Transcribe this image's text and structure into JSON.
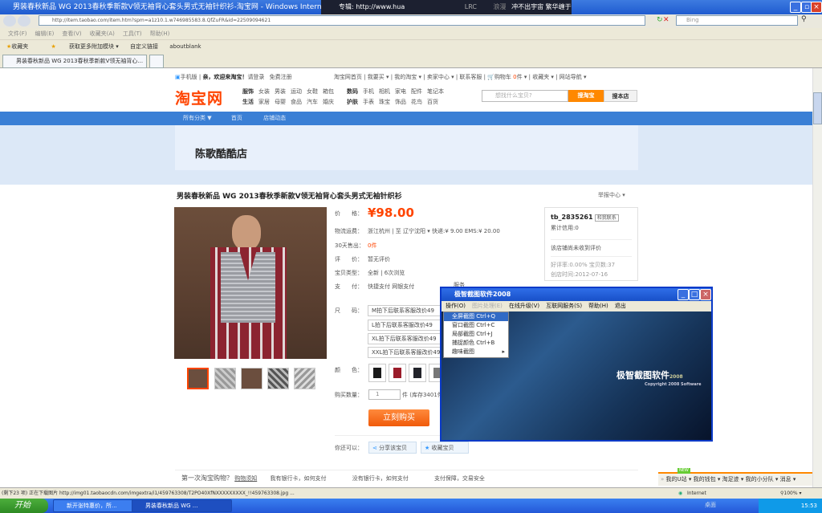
{
  "browser": {
    "title": "男装春秋新品 WG 2013春秋季新款V领无袖背心套头男式无袖针织衫-淘宝网 - Windows Internet",
    "url": "http://item.taobao.com/item.htm?spm=a1z10.1.w746985583.8.QfZuFR&id=22509094621",
    "search_placeholder": "Bing",
    "menu": [
      "文件(F)",
      "编辑(E)",
      "查看(V)",
      "收藏夹(A)",
      "工具(T)",
      "帮助(H)"
    ],
    "favorites": [
      "收藏夹",
      "获取更多附加模块 ▾",
      "自定义链接",
      "aboutblank"
    ],
    "tab": "男装春秋新品 WG 2013春秋季新款V领无袖背心...",
    "status": "(剩下23 项) 正在下载图片 http://img01.taobaocdn.com/imgextra/i1/459763308/T2PO40XfNXXXXXXXXX_!!459763308.jpg ...",
    "zone": "Internet",
    "zoom": "100%"
  },
  "player": {
    "label": "专辑: http://www.hua",
    "lyric_prefix": "浪漫",
    "lyric": "冲不出宇宙  繁华缠于大海",
    "lrc": "LRC"
  },
  "taobao": {
    "topbar": {
      "mobile": "手机版",
      "welcome": "亲，欢迎来淘宝！",
      "login": "请登录",
      "register": "免费注册",
      "links": [
        "淘宝网首页",
        "我要买 ▾",
        "我的淘宝 ▾",
        "卖家中心 ▾",
        "联系客服"
      ],
      "cart": "购物车",
      "cart_count": "0",
      "cart_unit": "件 ▾",
      "fav": "收藏夹 ▾",
      "sitenav": "网站导航 ▾"
    },
    "logo": "淘宝网",
    "cats_row1": [
      "服饰",
      "女装",
      "男装",
      "运动",
      "女鞋",
      "箱包",
      "数码",
      "手机",
      "相机",
      "家电",
      "配件",
      "笔记本"
    ],
    "cats_row2": [
      "生活",
      "家居",
      "母婴",
      "食品",
      "汽车",
      "婚庆",
      "护肤",
      "手表",
      "珠宝",
      "饰品",
      "花鸟",
      "百货"
    ],
    "search_placeholder": "想找什么宝贝?",
    "search_btn": "搜淘宝",
    "shop_btn": "搜本店",
    "nav": [
      "所有分类 ▼",
      "首页",
      "店铺动态"
    ]
  },
  "shop": {
    "name": "陈歌酷酷店"
  },
  "product": {
    "title": "男装春秋新品 WG 2013春秋季新款V领无袖背心套头男式无袖针织衫",
    "report": "举报中心",
    "price_label": "价　　格：",
    "price": "¥98.00",
    "ship_label": "物流运费：",
    "ship": "浙江杭州 | 至 辽宁沈阳 ▾   快递:¥ 9.00   EMS:¥ 20.00",
    "sold_label": "30天售出：",
    "sold": "0件",
    "review_label": "评　　价：",
    "review": "暂无评价",
    "type_label": "宝贝类型：",
    "type": "全新  |  6次浏览",
    "pay_label": "支　　付：",
    "pay": "快捷支付  网银支付",
    "service": "服务",
    "size_label": "尺　　码：",
    "sizes": [
      "M拍下后联系客服改价49",
      "L拍下后联系客服改价49",
      "XL拍下后联系客服改价49",
      "XXL拍下后联系客服改价49"
    ],
    "color_label": "颜　　色：",
    "colors": [
      "#1a1a1a",
      "#9a1c2a",
      "#22232a",
      "#777777"
    ],
    "qty_label": "购买数量：",
    "qty": "1",
    "qty_unit": "件 (库存3401件)",
    "buy": "立刻购买",
    "also_label": "你还可以：",
    "share": "分享该宝贝",
    "collect": "收藏宝贝"
  },
  "seller": {
    "name": "tb_2835261",
    "chat": "和我联系",
    "credit": "累计信用:0",
    "no_review": "该店铺尚未收到评价",
    "rate": "好评率:0.00%  宝贝数:37",
    "created": "创店时间:2012-07-16"
  },
  "dialog": {
    "title": "极智截图软件2008",
    "menu": [
      "操作(O)",
      "图片处理(E)",
      "在线升级(V)",
      "互联网服务(S)",
      "帮助(H)",
      "退出"
    ],
    "items": [
      {
        "label": "全屏截图",
        "key": "Ctrl+Q"
      },
      {
        "label": "窗口截图",
        "key": "Ctrl+C"
      },
      {
        "label": "局部截图",
        "key": "Ctrl+J"
      },
      {
        "label": "捕捉颜色",
        "key": "Ctrl+B"
      },
      {
        "label": "趣味截图",
        "key": "▸"
      }
    ],
    "brand": "极智截图软件",
    "brand_year": "2008",
    "copyright": "Copyright 2008 Software"
  },
  "footer": {
    "q": "第一次淘宝购物？",
    "link": "购物须知",
    "items": [
      "我有银行卡，如何支付",
      "没有银行卡，如何支付",
      "支付保障，交易安全"
    ]
  },
  "tbtoolbar": {
    "badge": "NEW",
    "items": [
      "我的U站 ▾",
      "我的钱包 ▾",
      "淘足迹 ▾",
      "我的小分队 ▾",
      "消息 ▾"
    ]
  },
  "taskbar": {
    "start": "开始",
    "tasks": [
      "新开张特惠价，所...",
      "男装春秋新品 WG ..."
    ],
    "desktop": "桌面",
    "clock": "15:53"
  }
}
